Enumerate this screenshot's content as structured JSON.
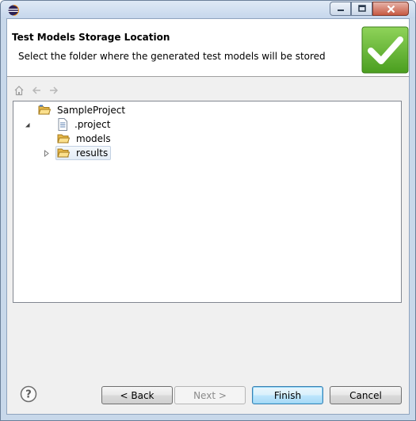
{
  "window": {
    "icon": "eclipse-icon",
    "controls": {
      "minimize": "minimize-icon",
      "maximize": "maximize-icon",
      "close": "close-icon"
    }
  },
  "header": {
    "title": "Test Models Storage Location",
    "description": "Select the folder where the generated test models will be stored",
    "banner_icon": "green-checkmark-icon"
  },
  "toolbar": {
    "home_icon": "home-icon",
    "back_icon": "back-arrow-icon",
    "forward_icon": "forward-arrow-icon"
  },
  "tree": {
    "root": {
      "label": "SampleProject",
      "icon": "open-project-folder-icon",
      "expanded": true
    },
    "children": [
      {
        "label": ".project",
        "icon": "file-icon",
        "has_children": false,
        "selected": false
      },
      {
        "label": "models",
        "icon": "folder-icon",
        "has_children": true,
        "selected": false
      },
      {
        "label": "results",
        "icon": "folder-icon",
        "has_children": false,
        "selected": true
      }
    ]
  },
  "buttons": {
    "help_icon": "help-icon",
    "back": "< Back",
    "next": "Next >",
    "finish": "Finish",
    "cancel": "Cancel"
  },
  "colors": {
    "accent": "#3c7fb1",
    "banner_green": "#59b12b",
    "folder_yellow": "#e8b94a"
  }
}
